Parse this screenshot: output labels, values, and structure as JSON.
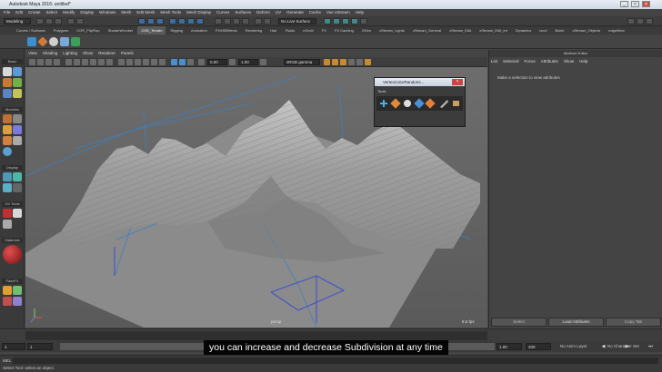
{
  "window": {
    "title": "Autodesk Maya 2016: untitled*",
    "controls": [
      "_",
      "□",
      "✕"
    ]
  },
  "menubar": [
    "File",
    "Edit",
    "Create",
    "Select",
    "Modify",
    "Display",
    "Windows",
    "Mesh",
    "Edit Mesh",
    "Mesh Tools",
    "Mesh Display",
    "Curves",
    "Surfaces",
    "Deform",
    "UV",
    "Generate",
    "Cache",
    "Vue xStream",
    "Help"
  ],
  "statusline": {
    "mode": "Modeling",
    "live_surface": "No Live Surface"
  },
  "shelf_tabs": [
    {
      "label": "Curves / Surfaces",
      "active": false
    },
    {
      "label": "Polygons",
      "active": false
    },
    {
      "label": "CGR_FlipFlop",
      "active": false
    },
    {
      "label": "ShaderWrecker",
      "active": false
    },
    {
      "label": "CGE_Terrain",
      "active": true
    },
    {
      "label": "Rigging",
      "active": false
    },
    {
      "label": "Animation",
      "active": false
    },
    {
      "label": "FX/HBEffects",
      "active": false
    },
    {
      "label": "Rendering",
      "active": false
    },
    {
      "label": "Hair",
      "active": false
    },
    {
      "label": "Fluids",
      "active": false
    },
    {
      "label": "nCloth",
      "active": false
    },
    {
      "label": "FX",
      "active": false
    },
    {
      "label": "FX Caching",
      "active": false
    },
    {
      "label": "XGen",
      "active": false
    },
    {
      "label": "xStream_Lights",
      "active": false
    },
    {
      "label": "xStream_General",
      "active": false
    },
    {
      "label": "xStream_Edit",
      "active": false
    },
    {
      "label": "xStream_Edit_int",
      "active": false
    },
    {
      "label": "Dynamics",
      "active": false
    },
    {
      "label": "Iscol",
      "active": false
    },
    {
      "label": "Bullet",
      "active": false
    },
    {
      "label": "xStream_Objects",
      "active": false
    },
    {
      "label": "edgeMerc",
      "active": false
    }
  ],
  "toolbox_labels": [
    "Basic",
    "Modules",
    "Display",
    "UV Tools",
    "Materials",
    "PaintFX"
  ],
  "viewport": {
    "menu": [
      "View",
      "Shading",
      "Lighting",
      "Show",
      "Renderer",
      "Panels"
    ],
    "field_a": "0.00",
    "field_b": "1.00",
    "color_space": "sRGB gamma",
    "camera_label": "persp",
    "fps": "8.6 fps"
  },
  "float_window": {
    "title": "VertexColorRandomi...",
    "tab": "Tools"
  },
  "attribute_editor": {
    "title": "Attribute Editor",
    "menu": [
      "List",
      "Selected",
      "Focus",
      "Attributes",
      "Show",
      "Help"
    ],
    "message": "Make a selection to view attributes",
    "buttons": [
      "Select",
      "Load Attributes",
      "Copy Tab"
    ]
  },
  "range": {
    "start": "1",
    "start2": "1",
    "end": "120",
    "end2": "200",
    "current": "1.00",
    "anim_layer": "No Anim Layer",
    "char_set": "No Character Set"
  },
  "command_line": {
    "lang": "MEL"
  },
  "help_line": "Select Tool: select an object",
  "subtitle": "you can increase and decrease Subdivision at any time",
  "colors": {
    "accent": "#3b6d9e",
    "wire": "#4452c8",
    "grid": "#3f7fbf",
    "terrain": "#9a9a9a"
  }
}
